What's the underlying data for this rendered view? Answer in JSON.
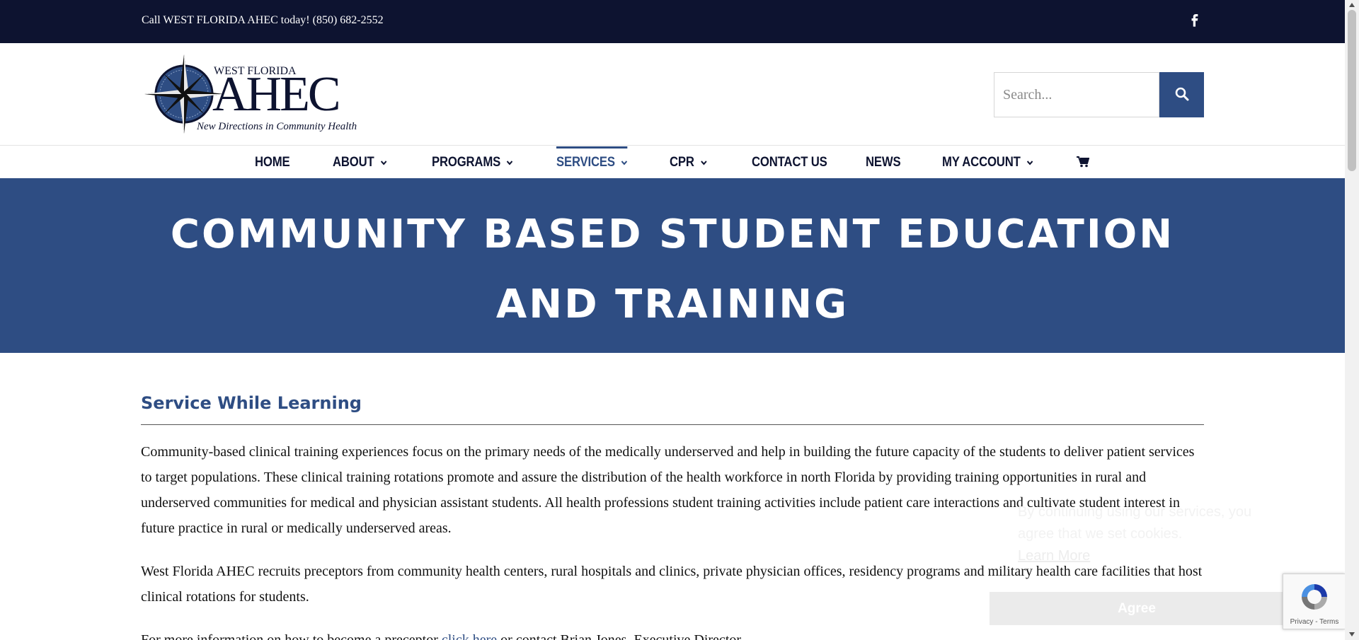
{
  "topbar": {
    "phone_text": "Call WEST FLORIDA AHEC today! (850) 682-2552",
    "facebook_icon": "facebook-icon"
  },
  "logo": {
    "small_text": "WEST FLORIDA",
    "big_text": "AHEC",
    "tagline": "New Directions in Community Health",
    "icon": "compass-star-icon"
  },
  "search": {
    "placeholder": "Search...",
    "icon": "search-icon"
  },
  "nav": {
    "items": [
      {
        "label": "HOME",
        "dropdown": false
      },
      {
        "label": "ABOUT",
        "dropdown": true
      },
      {
        "label": "PROGRAMS",
        "dropdown": true
      },
      {
        "label": "SERVICES",
        "dropdown": true,
        "active": true
      },
      {
        "label": "CPR",
        "dropdown": true
      },
      {
        "label": "CONTACT US",
        "dropdown": false
      },
      {
        "label": "NEWS",
        "dropdown": false
      },
      {
        "label": "MY ACCOUNT",
        "dropdown": true
      }
    ],
    "cart_icon": "shopping-cart-icon"
  },
  "hero": {
    "title": "COMMUNITY BASED STUDENT EDUCATION AND TRAINING"
  },
  "content": {
    "heading": "Service While Learning",
    "paragraph1": "Community-based clinical training experiences focus on the primary needs of the medically underserved and help in building the future capacity of the students to deliver patient services to target populations. These clinical training rotations promote and assure the distribution of the health workforce in north Florida by providing training opportunities in rural and underserved communities for medical and physician assistant students. All health professions student training activities include patient care interactions and cultivate student interest in future practice in rural or medically underserved areas.",
    "paragraph2": "West Florida AHEC recruits preceptors from community health centers, rural hospitals and clinics, private physician offices, residency programs and military health care facilities that host clinical rotations for students.",
    "paragraph3_start": "For more information on how to become a preceptor ",
    "paragraph3_link": "click here",
    "paragraph3_end": " or contact Brian Jones, Executive Director."
  },
  "cookie": {
    "text_before": "By continuing using our services, you agree that we set cookies.",
    "learn_more": "Learn More",
    "agree_button": "Agree"
  },
  "recaptcha": {
    "terms": "Privacy - Terms",
    "icon": "recaptcha-icon"
  },
  "colors": {
    "topbar_bg": "#0d1330",
    "brand_blue": "#2e4d83",
    "nav_text": "#0d1330"
  }
}
